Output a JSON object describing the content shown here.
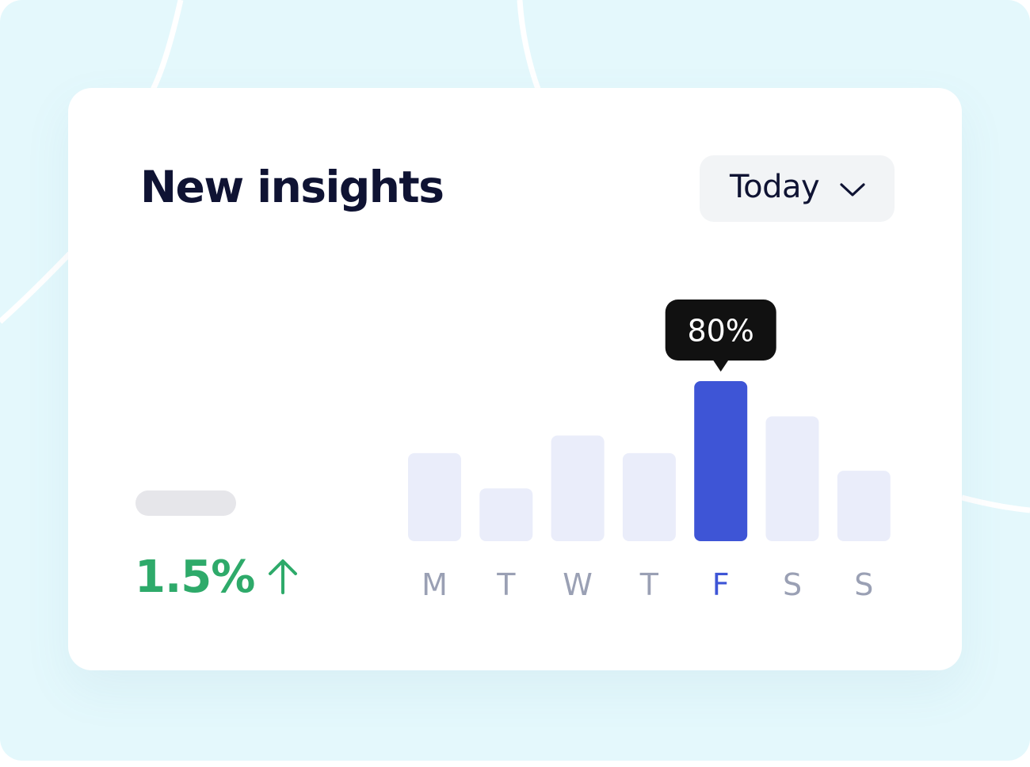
{
  "card": {
    "title": "New insights",
    "period_select": {
      "selected": "Today",
      "icon": "chevron-down-icon"
    }
  },
  "stat": {
    "value": "1.5%",
    "trend_icon": "arrow-up-icon",
    "color": "#2eaa6a"
  },
  "chart_data": {
    "type": "bar",
    "categories": [
      "M",
      "T",
      "W",
      "T",
      "F",
      "S",
      "S"
    ],
    "values": [
      55,
      33,
      66,
      55,
      100,
      78,
      44
    ],
    "highlighted_index": 4,
    "tooltip": "80%",
    "grid": false,
    "ylim": [
      0,
      100
    ],
    "colors": {
      "bar": "#eaedfa",
      "highlight": "#3e55d6",
      "label": "#9aa0b4",
      "label_highlight": "#3e55d6",
      "tooltip_bg": "#111111",
      "tooltip_text": "#ffffff"
    }
  }
}
